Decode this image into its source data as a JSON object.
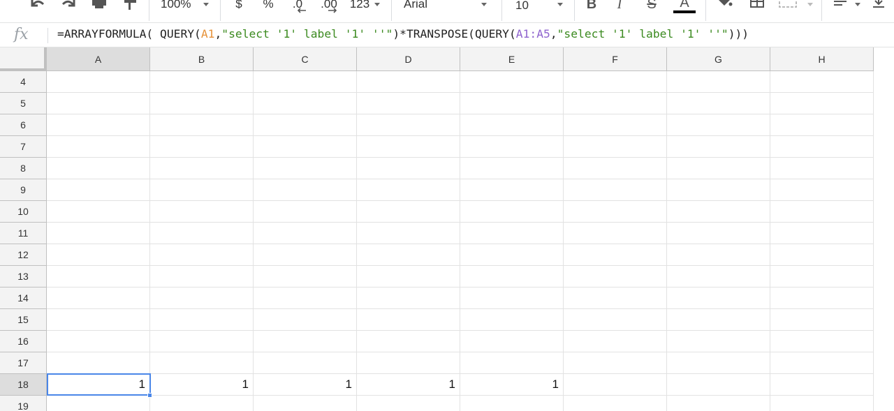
{
  "toolbar": {
    "zoom": "100%",
    "currency": "$",
    "percent": "%",
    "decrease_decimals": ".0",
    "increase_decimals": ".00",
    "more_formats": "123",
    "font": "Arial",
    "font_size": "10",
    "bold": "B",
    "italic": "I",
    "strikethrough": "S",
    "text_color": "A",
    "text_color_value": "#000000"
  },
  "formula_bar": {
    "fx": "fx",
    "formula": {
      "p1": "=ARRAYFORMULA( QUERY(",
      "r1": "A1",
      "p2": ",",
      "s1": "\"select '1' label '1' ''\"",
      "p3": ")*TRANSPOSE(QUERY(",
      "r2": "A1:A5",
      "p4": ",",
      "s2": "\"select '1' label '1' ''\"",
      "p5": ")))"
    }
  },
  "columns": [
    "A",
    "B",
    "C",
    "D",
    "E",
    "F",
    "G",
    "H"
  ],
  "rows": [
    "4",
    "5",
    "6",
    "7",
    "8",
    "9",
    "10",
    "11",
    "12",
    "13",
    "14",
    "15",
    "16",
    "17",
    "18",
    "19"
  ],
  "active_column": "A",
  "active_row": "18",
  "cells": [
    {
      "row": "18",
      "col": "A",
      "value": "1"
    },
    {
      "row": "18",
      "col": "B",
      "value": "1"
    },
    {
      "row": "18",
      "col": "C",
      "value": "1"
    },
    {
      "row": "18",
      "col": "D",
      "value": "1"
    },
    {
      "row": "18",
      "col": "E",
      "value": "1"
    }
  ],
  "colors": {
    "selection": "#4a86e8",
    "header_bg": "#f3f3f3",
    "active_header_bg": "#dddddd"
  }
}
